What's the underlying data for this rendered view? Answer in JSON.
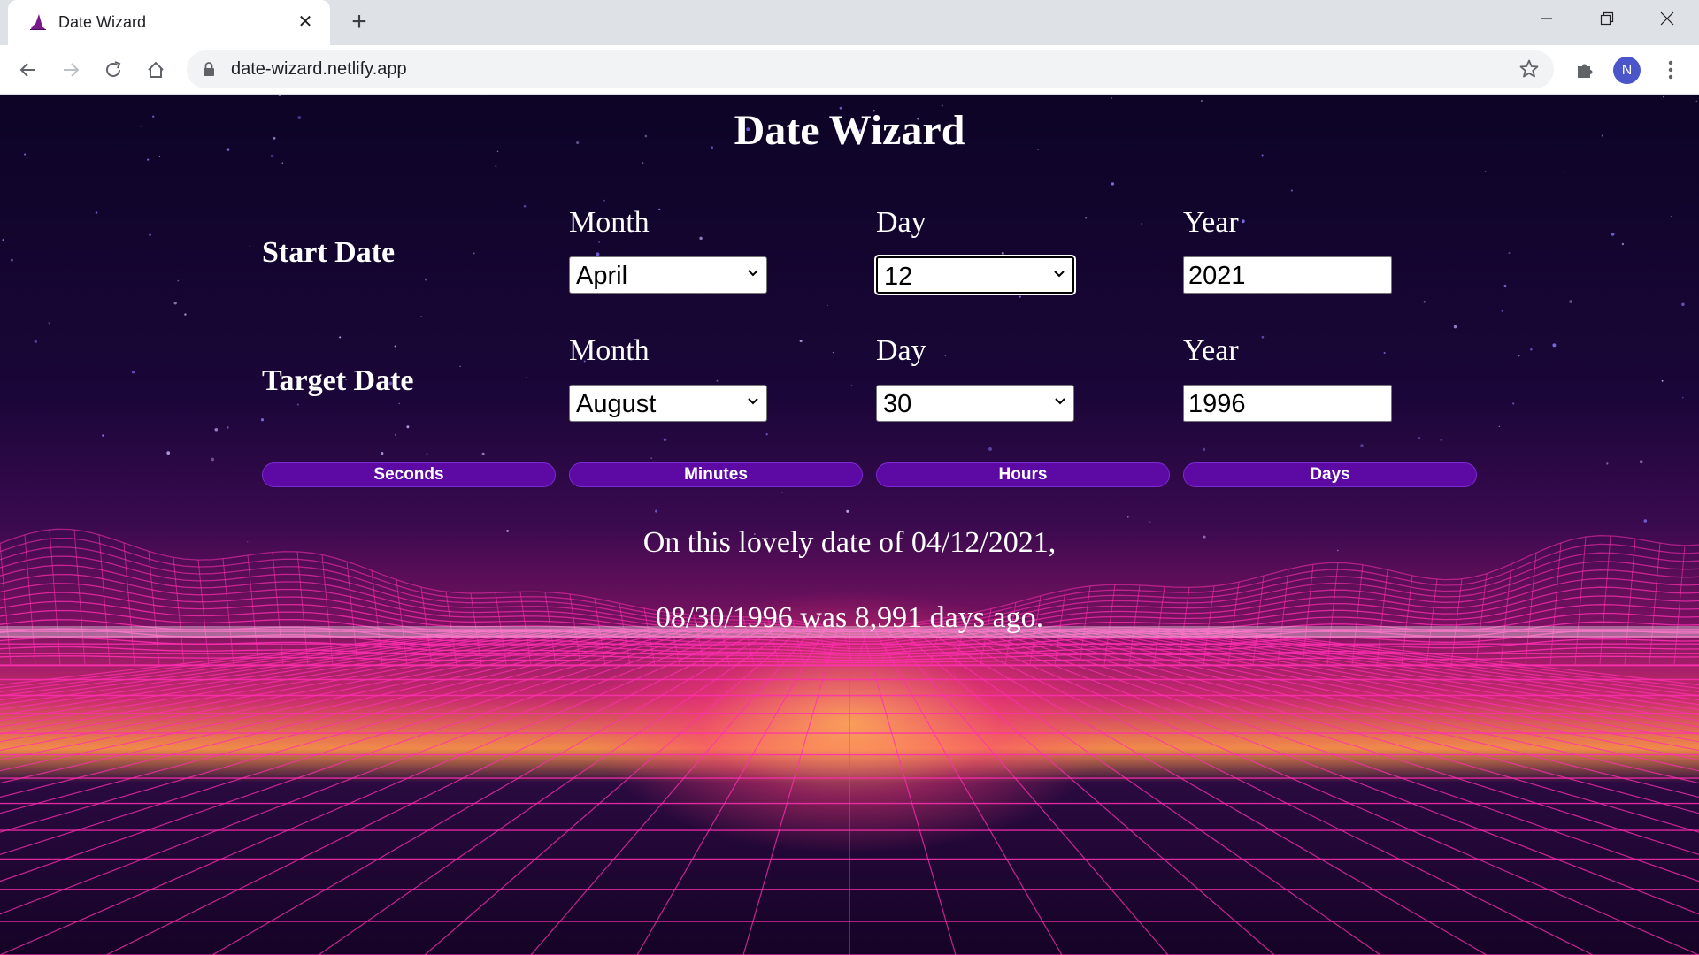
{
  "browser": {
    "tab_title": "Date Wizard",
    "url": "date-wizard.netlify.app",
    "profile_initial": "N"
  },
  "app": {
    "title": "Date Wizard",
    "start": {
      "label": "Start Date",
      "month_label": "Month",
      "day_label": "Day",
      "year_label": "Year",
      "month": "April",
      "day": "12",
      "year": "2021"
    },
    "target": {
      "label": "Target Date",
      "month_label": "Month",
      "day_label": "Day",
      "year_label": "Year",
      "month": "August",
      "day": "30",
      "year": "1996"
    },
    "buttons": {
      "seconds": "Seconds",
      "minutes": "Minutes",
      "hours": "Hours",
      "days": "Days"
    },
    "result": {
      "line1": "On this lovely date of 04/12/2021,",
      "line2": "08/30/1996 was 8,991 days ago."
    }
  },
  "colors": {
    "button_bg": "#5c0aa3",
    "accent_pink": "#ff2fb0",
    "sky_top": "#0d0426"
  }
}
